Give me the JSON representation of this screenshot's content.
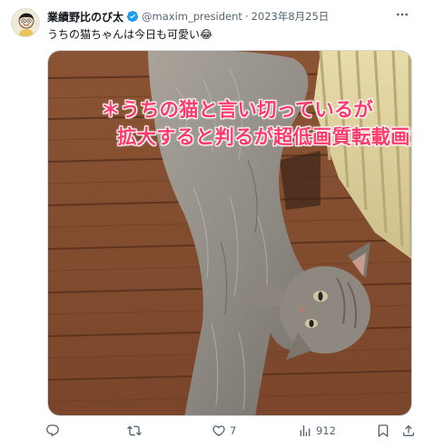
{
  "author": {
    "name": "業績野比のび太",
    "handle": "@maxim_president",
    "separator": "·",
    "date": "2023年8月25日"
  },
  "tweet": {
    "text": "うちの猫ちゃんは今日も可愛い😂"
  },
  "media": {
    "overlay_line1": "＊うちの猫と言い切っているが",
    "overlay_line2": "拡大すると判るが超低画質転載画質"
  },
  "actions": {
    "reply_count": "",
    "retweet_count": "",
    "like_count": "7",
    "views_count": "912"
  },
  "colors": {
    "verified": "#1d9bf0",
    "overlay_text": "#ff3b6b",
    "meta_text": "#536471"
  }
}
